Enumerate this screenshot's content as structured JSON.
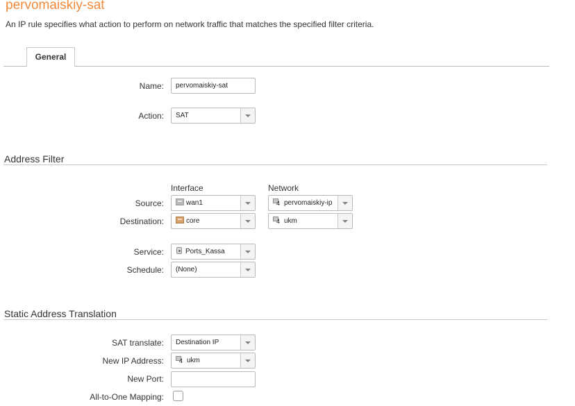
{
  "page": {
    "title": "pervomaiskiy-sat",
    "description": "An IP rule specifies what action to perform on network traffic that matches the specified filter criteria."
  },
  "tabs": {
    "general": "General"
  },
  "general": {
    "name_label": "Name:",
    "name_value": "pervomaiskiy-sat",
    "action_label": "Action:",
    "action_value": "SAT"
  },
  "address_filter": {
    "section_title": "Address Filter",
    "interface_header": "Interface",
    "network_header": "Network",
    "source_label": "Source:",
    "source_interface": "wan1",
    "source_network": "pervomaiskiy-ip",
    "destination_label": "Destination:",
    "destination_interface": "core",
    "destination_network": "ukm",
    "service_label": "Service:",
    "service_value": "Ports_Kassa",
    "schedule_label": "Schedule:",
    "schedule_value": "(None)",
    "network_icon_badge": "4"
  },
  "sat": {
    "section_title": "Static Address Translation",
    "translate_label": "SAT translate:",
    "translate_value": "Destination IP",
    "new_ip_label": "New IP Address:",
    "new_ip_value": "ukm",
    "new_port_label": "New Port:",
    "new_port_value": "",
    "all_to_one_label": "All-to-One Mapping:",
    "all_to_one_checked": false
  },
  "colors": {
    "title": "#f08a3c",
    "text": "#333333",
    "border": "#b9b9b9"
  },
  "icons": {
    "interface_wan": "interface-icon",
    "interface_core": "core-interface-icon",
    "network": "network-object-icon",
    "service": "service-icon"
  }
}
